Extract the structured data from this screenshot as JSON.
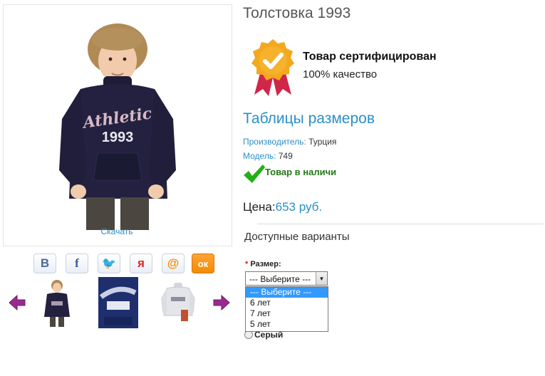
{
  "product": {
    "title": "Толстовка 1993",
    "download_label": "Скачать"
  },
  "certificate": {
    "title": "Товар сертифицирован",
    "subtitle": "100% качество"
  },
  "size_table_link": "Таблицы размеров",
  "meta": {
    "manufacturer_label": "Производитель:",
    "manufacturer_value": "Турция",
    "model_label": "Модель:",
    "model_value": "749"
  },
  "stock_text": "Товар в наличи",
  "price": {
    "label": "Цена:",
    "value": "653 руб."
  },
  "variants_title": "Доступные варианты",
  "size": {
    "required_mark": "*",
    "label": "Размер:",
    "selected": "--- Выберите ---",
    "options": [
      "--- Выберите ---",
      "6 лет",
      "7 лет",
      "5 лет"
    ]
  },
  "color_option": "Серый",
  "sweater_print": {
    "word": "Athletic",
    "year": "1993"
  },
  "social": [
    {
      "glyph": "В",
      "icon": "vkontakte-icon",
      "color": "#4a6a95"
    },
    {
      "glyph": "f",
      "icon": "facebook-icon",
      "color": "#3b5998"
    },
    {
      "glyph": "🐦",
      "icon": "twitter-icon",
      "color": "#29a9e1"
    },
    {
      "glyph": "я",
      "icon": "yaru-icon",
      "color": "#e02424"
    },
    {
      "glyph": "@",
      "icon": "mailru-icon",
      "color": "#f28c00"
    },
    {
      "glyph": "ок",
      "icon": "odnoklassniki-icon",
      "color": "#f28c00"
    }
  ],
  "colors": {
    "link": "#2a8fc8",
    "in_stock": "#247a18",
    "badge": "#f3a81d",
    "ribbon": "#d0264a",
    "arrow": "#9a2a8f"
  }
}
